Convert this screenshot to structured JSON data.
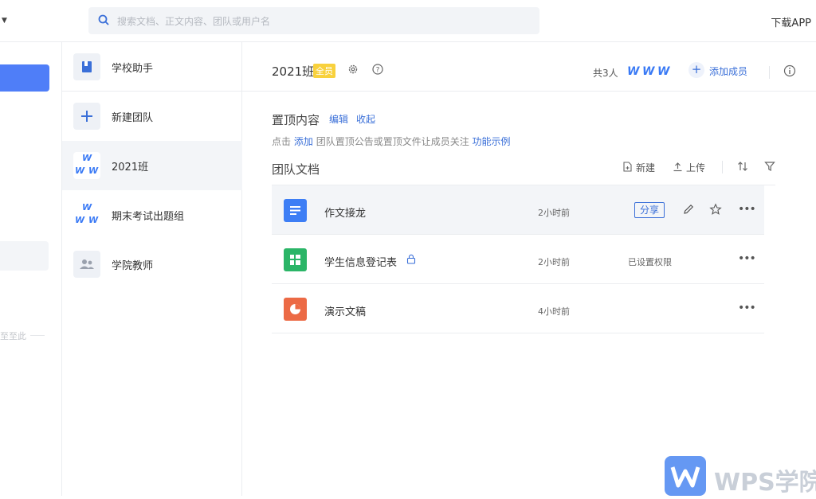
{
  "topbar": {
    "search_placeholder": "搜索文档、正文内容、团队或用户名",
    "download_label": "下载APP"
  },
  "leftnav": {
    "hint_text": "至至此"
  },
  "teams": [
    {
      "name": "学校助手",
      "icon": "school-book-icon"
    },
    {
      "name": "新建团队",
      "icon": "plus-icon"
    },
    {
      "name": "2021班",
      "icon": "wps-logo-cluster-icon",
      "selected": true
    },
    {
      "name": "期末考试出题组",
      "icon": "wps-logo-cluster-icon"
    },
    {
      "name": "学院教师",
      "icon": "people-icon"
    }
  ],
  "team_header": {
    "title": "2021班",
    "badge": "全员",
    "members_count": "共3人",
    "add_member_label": "添加成员"
  },
  "pinned": {
    "title": "置顶内容",
    "edit_label": "编辑",
    "collapse_label": "收起",
    "desc_prefix": "点击",
    "desc_link_add": "添加",
    "desc_middle": "团队置顶公告或置顶文件让成员关注",
    "desc_link_example": "功能示例"
  },
  "docs": {
    "title": "团队文档",
    "new_label": "新建",
    "upload_label": "上传",
    "files": [
      {
        "name": "作文接龙",
        "time": "2小时前",
        "icon": "writer-doc-icon",
        "color": "#3d7ef5",
        "share_label": "分享"
      },
      {
        "name": "学生信息登记表",
        "time": "2小时前",
        "icon": "spreadsheet-icon",
        "color": "#2bb567",
        "perm": "已设置权限"
      },
      {
        "name": "演示文稿",
        "time": "4小时前",
        "icon": "presentation-icon",
        "color": "#ec6a45"
      }
    ]
  },
  "watermark": {
    "text": "WPS学院"
  }
}
